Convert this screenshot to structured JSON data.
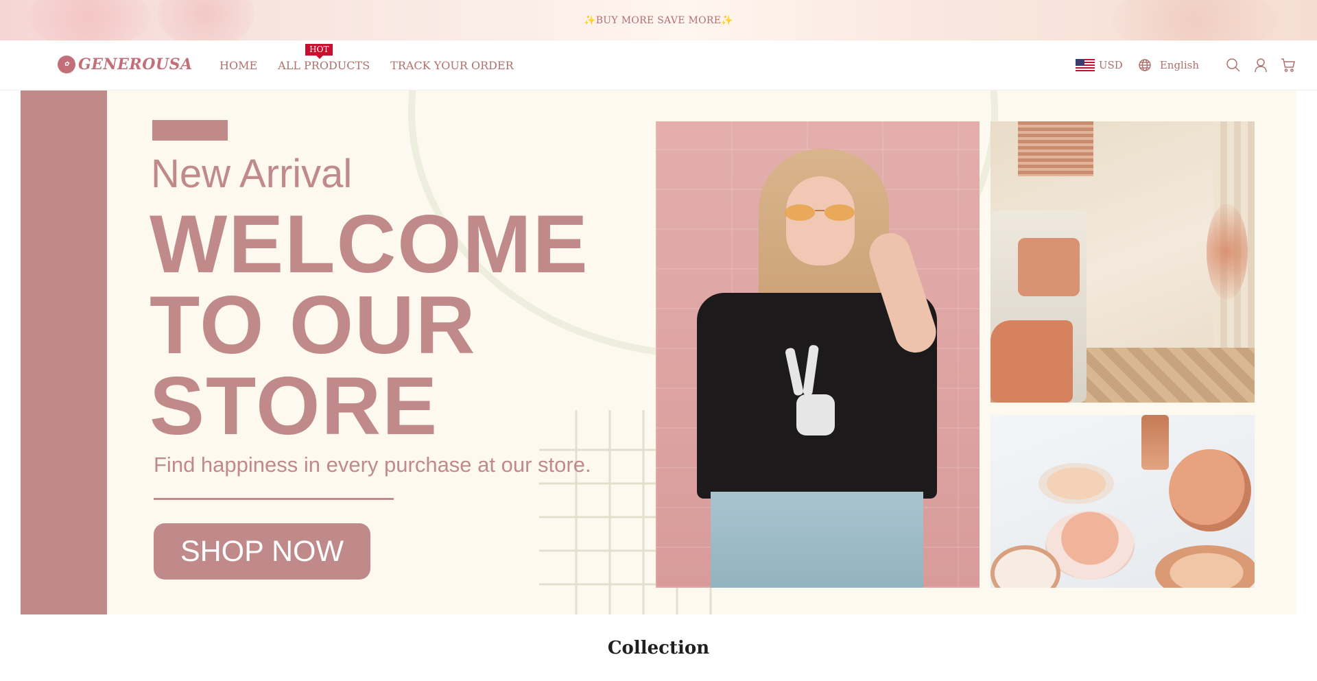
{
  "announcement": {
    "text": "✨BUY MORE SAVE MORE✨"
  },
  "header": {
    "logo_text": "GENEROUSA",
    "nav": [
      {
        "label": "HOME"
      },
      {
        "label": "ALL PRODUCTS",
        "badge": "HOT"
      },
      {
        "label": "TRACK YOUR ORDER"
      }
    ],
    "currency": {
      "code": "USD",
      "flag_icon": "us-flag-icon"
    },
    "language": {
      "label": "English",
      "icon": "globe-icon"
    },
    "icons": [
      "search-icon",
      "account-icon",
      "cart-icon"
    ]
  },
  "hero": {
    "kicker": "New Arrival",
    "title_lines": [
      "WELCOME",
      "TO OUR",
      "STORE"
    ],
    "subtitle": "Find happiness in every purchase at our store.",
    "button_label": "SHOP NOW"
  },
  "collection": {
    "title": "Collection"
  },
  "colors": {
    "brand": "#c08a8b",
    "text_accent": "#b0706e",
    "hot_badge": "#c8102e",
    "hero_bg": "#fdf9ee"
  }
}
